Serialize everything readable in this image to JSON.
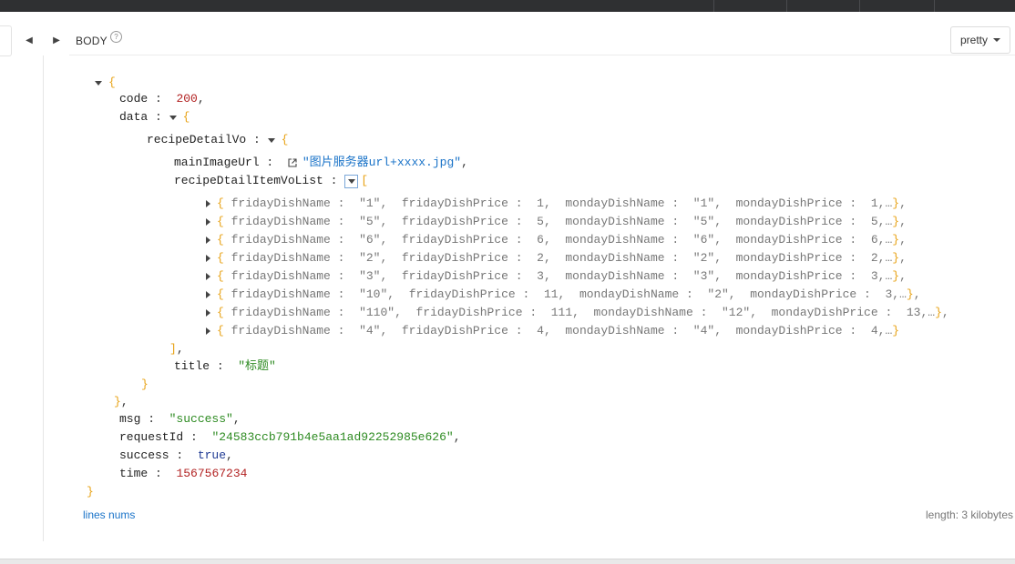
{
  "toolbar": {
    "body_label": "BODY",
    "help_icon": "question-circle-icon",
    "view_mode": "pretty"
  },
  "json": {
    "code_key": "code",
    "code_val": "200",
    "data_key": "data",
    "recipe_key": "recipeDetailVo",
    "main_image_key": "mainImageUrl",
    "main_image_val": "\"图片服务器url+xxxx.jpg\"",
    "list_key": "recipeDtailItemVoList",
    "items": [
      {
        "fname": "\"1\"",
        "fprice": "1",
        "mname": "\"1\"",
        "mprice": "1"
      },
      {
        "fname": "\"5\"",
        "fprice": "5",
        "mname": "\"5\"",
        "mprice": "5"
      },
      {
        "fname": "\"6\"",
        "fprice": "6",
        "mname": "\"6\"",
        "mprice": "6"
      },
      {
        "fname": "\"2\"",
        "fprice": "2",
        "mname": "\"2\"",
        "mprice": "2"
      },
      {
        "fname": "\"3\"",
        "fprice": "3",
        "mname": "\"3\"",
        "mprice": "3"
      },
      {
        "fname": "\"10\"",
        "fprice": "11",
        "mname": "\"2\"",
        "mprice": "3"
      },
      {
        "fname": "\"110\"",
        "fprice": "111",
        "mname": "\"12\"",
        "mprice": "13"
      },
      {
        "fname": "\"4\"",
        "fprice": "4",
        "mname": "\"4\"",
        "mprice": "4"
      }
    ],
    "item_keys": {
      "fname": "fridayDishName",
      "fprice": "fridayDishPrice",
      "mname": "mondayDishName",
      "mprice": "mondayDishPrice"
    },
    "title_key": "title",
    "title_val": "\"标题\"",
    "msg_key": "msg",
    "msg_val": "\"success\"",
    "request_key": "requestId",
    "request_val": "\"24583ccb791b4e5aa1ad92252985e626\"",
    "success_key": "success",
    "success_val": "true",
    "time_key": "time",
    "time_val": "1567567234"
  },
  "footer": {
    "lines_nums": "lines nums",
    "length": "length: 3 kilobytes"
  },
  "colors": {
    "brace": "#e8a317",
    "number": "#b22222",
    "string": "#2e8b22",
    "link": "#1a73c8",
    "boolean": "#1f3a93"
  }
}
